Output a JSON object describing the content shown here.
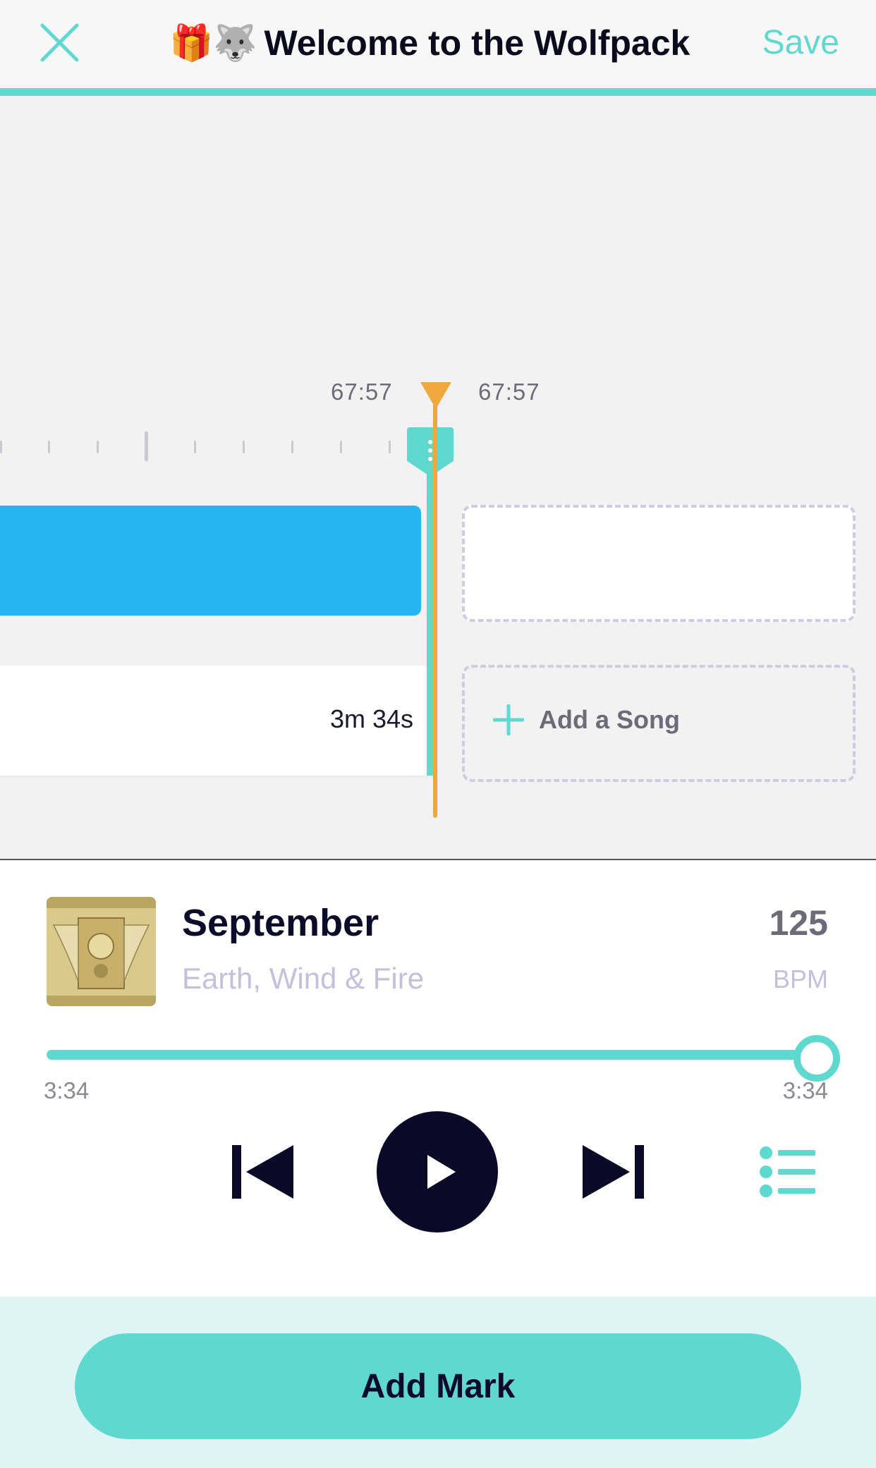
{
  "header": {
    "title_emoji": "🎁🐺",
    "title": "Welcome to the Wolfpack",
    "save_label": "Save",
    "accent_color": "#5fd8d0"
  },
  "timeline": {
    "time_left": "67:57",
    "time_right": "67:57",
    "song_duration": "3m 34s",
    "add_song_label": "Add a Song",
    "playhead_color": "#f0a83e",
    "block_color": "#27b5f2"
  },
  "player": {
    "album_icon": "album-art-earth-wind-fire",
    "song_title": "September",
    "artist": "Earth, Wind & Fire",
    "bpm_value": "125",
    "bpm_label": "BPM",
    "progress": 1.0,
    "time_elapsed": "3:34",
    "time_total": "3:34"
  },
  "footer": {
    "add_mark_label": "Add Mark"
  }
}
